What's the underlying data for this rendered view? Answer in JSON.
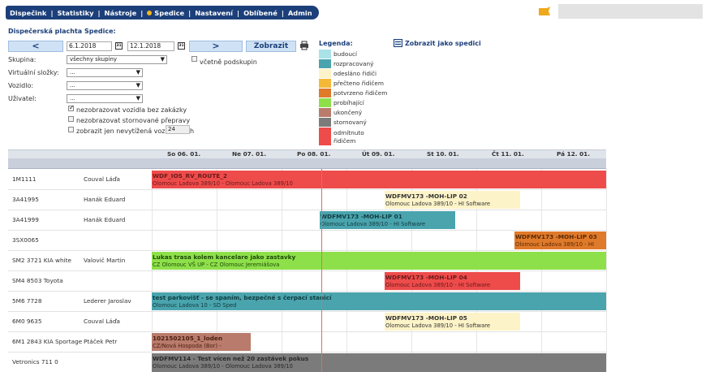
{
  "nav": {
    "items": [
      "Dispečink",
      "Statistiky",
      "Nástroje",
      "Spedice",
      "Nastavení",
      "Oblíbené",
      "Admin"
    ],
    "active_dot_color": "#f3b51b"
  },
  "panel": {
    "title": "Dispečerská plachta Spedice:",
    "prev_label": "<",
    "next_label": ">",
    "date_from": "6.1.2018",
    "date_to": "12.1.2018",
    "calendar_icon_text": "31",
    "show_label": "Zobrazit",
    "group_label": "Skupina:",
    "group_value": "všechny skupiny",
    "include_subgroups_label": "včetně podskupin",
    "virtual_label": "Virtuální složky:",
    "virtual_value": "...",
    "vehicle_label": "Vozidlo:",
    "vehicle_value": "...",
    "user_label": "Uživatel:",
    "user_value": "...",
    "hide_no_order_label": "nezobrazovat vozidla bez zakázky",
    "hide_cancelled_label": "nezobrazovat stornované přepravy",
    "unloaded_label": "zobrazit jen nevytížená vozidla",
    "unloaded_value": "24",
    "unloaded_unit": "h"
  },
  "legend": {
    "title": "Legenda:",
    "show_as_spedice": "Zobrazit jako spedici",
    "items": [
      {
        "label": "budoucí",
        "color": "#a9e3e8"
      },
      {
        "label": "rozpracovaný",
        "color": "#4aa4ad"
      },
      {
        "label": "odesláno řidiči",
        "color": "#fdf3c8"
      },
      {
        "label": "přečteno řidičem",
        "color": "#f5b93a"
      },
      {
        "label": "potvrzeno řidičem",
        "color": "#e07a2b"
      },
      {
        "label": "probíhající",
        "color": "#8ee04a"
      },
      {
        "label": "ukončený",
        "color": "#b97b6b"
      },
      {
        "label": "stornovaný",
        "color": "#7b7b7b"
      },
      {
        "label": "odmítnuto řidičem",
        "color": "#ee4b4b"
      }
    ]
  },
  "gantt": {
    "days": [
      "So 06. 01.",
      "Ne 07. 01.",
      "Po 08. 01.",
      "Út 09. 01.",
      "St 10. 01.",
      "Čt 11. 01.",
      "Pá 12. 01."
    ],
    "rows": [
      {
        "vehicle": "1M1111",
        "driver": "Couval Láďa"
      },
      {
        "vehicle": "3A41995",
        "driver": "Hanák Eduard"
      },
      {
        "vehicle": "3A41999",
        "driver": "Hanák Eduard"
      },
      {
        "vehicle": "3SX0065",
        "driver": ""
      },
      {
        "vehicle": "SM2 3721 KIA white",
        "driver": "Valovič Martin"
      },
      {
        "vehicle": "SM4 8503 Toyota",
        "driver": ""
      },
      {
        "vehicle": "5M6 7728",
        "driver": "Lederer Jaroslav"
      },
      {
        "vehicle": "6M0 9635",
        "driver": "Couval Láďa"
      },
      {
        "vehicle": "6M1 2843 KIA Sportage",
        "driver": "Ptáček Petr"
      },
      {
        "vehicle": "Vetronics 711 0",
        "driver": ""
      }
    ],
    "bars": [
      {
        "title": "WDF_IOS_RV_ROUTE_2",
        "subtitle": "Olomouc Ladova 389/10 - Olomouc Ladova 389/10",
        "color": "#ee4b4b",
        "text_color": "#6a1a1a"
      },
      {
        "title": "WDFMV173 -MOH-LIP 02",
        "subtitle": "Olomouc Ladova 389/10 - HI Software",
        "color": "#fdf3c8",
        "text_color": "#333333"
      },
      {
        "title": "WDFMV173 -MOH-LIP 01",
        "subtitle": "Olomouc Ladova 389/10 - HI Software",
        "color": "#4aa4ad",
        "text_color": "#0f3c40"
      },
      {
        "title": "WDFMV173 -MOH-LIP 03",
        "subtitle": "Olomouc Ladova 389/10 - HI",
        "color": "#e07a2b",
        "text_color": "#5a2a05"
      },
      {
        "title": "Lukas trasa kolem kancelare jako zastavky",
        "subtitle": "CZ Olomouc VŠ UP - CZ Olomouc Jeremiášova",
        "color": "#8ee04a",
        "text_color": "#1f4a08"
      },
      {
        "title": "WDFMV173 -MOH-LIP 04",
        "subtitle": "Olomouc Ladova 389/10 - HI Software",
        "color": "#ee4b4b",
        "text_color": "#6a1a1a"
      },
      {
        "title": "test parkovišť - se spaním, bezpečné s čerpací stanicí",
        "subtitle": "Olomouc Ladova 10 - SD Sped",
        "color": "#4aa4ad",
        "text_color": "#0f3c40"
      },
      {
        "title": "WDFMV173 -MOH-LIP 05",
        "subtitle": "Olomouc Ladova 389/10 - HI Software",
        "color": "#fdf3c8",
        "text_color": "#333333"
      },
      {
        "title": "1021502105_1_loden",
        "subtitle": "CZ/Nová Hospoda (Bor) -",
        "color": "#b97b6b",
        "text_color": "#4a1e12"
      },
      {
        "title": "WDFMV114 - Test vícen než 20 zastávek pokus",
        "subtitle": "Olomouc Ladova 389/10 - Olomouc Ladova 389/10",
        "color": "#7b7b7b",
        "text_color": "#2a2a2a"
      }
    ]
  }
}
